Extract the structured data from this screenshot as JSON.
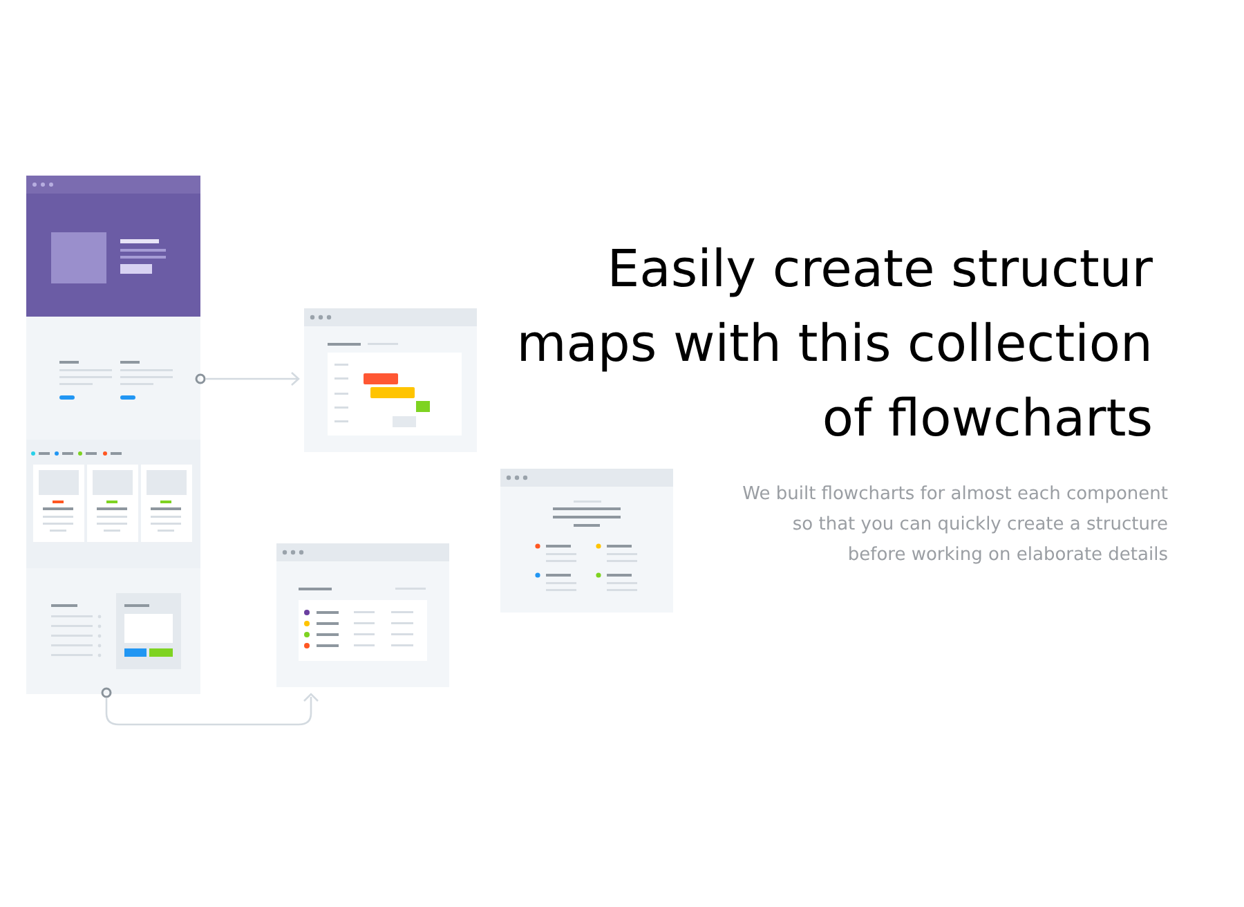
{
  "headline": {
    "lines": [
      "Easily create structur",
      "maps with this collection",
      "of flowcharts"
    ]
  },
  "description": {
    "lines": [
      "We built flowcharts for almost each component",
      "so that you can quickly create a structure",
      "before working on elaborate details"
    ]
  }
}
